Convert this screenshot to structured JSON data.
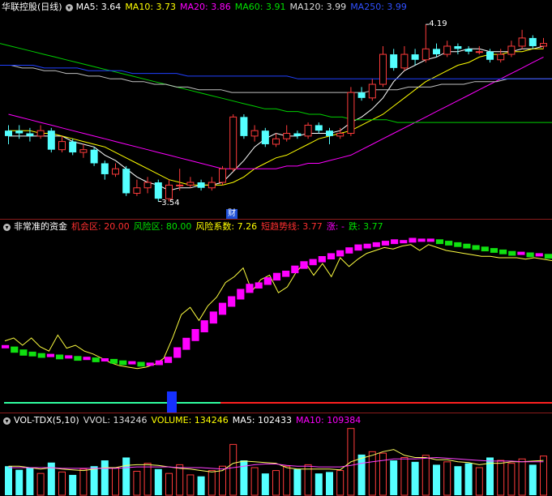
{
  "main_panel": {
    "title": "华联控股(日线)",
    "ma_items": [
      {
        "label": "MA5: 3.64",
        "color": "#ffffff"
      },
      {
        "label": "MA10: 3.73",
        "color": "#ffff00"
      },
      {
        "label": "MA20: 3.86",
        "color": "#ff00ff"
      },
      {
        "label": "MA60: 3.91",
        "color": "#00e000"
      },
      {
        "label": "MA120: 3.99",
        "color": "#dddddd"
      },
      {
        "label": "MA250: 3.99",
        "color": "#3050ff"
      }
    ],
    "high_label": "4.19",
    "low_label": "3.54",
    "finance_badge": "财"
  },
  "indicator_panel": {
    "title": "非常准的资金",
    "items": [
      {
        "label": "机会区: 20.00",
        "color": "#ff3030"
      },
      {
        "label": "风险区: 80.00",
        "color": "#00e000"
      },
      {
        "label": "风险系数: 7.26",
        "color": "#ffff00"
      },
      {
        "label": "短趋势线: 3.77",
        "color": "#ff3030"
      },
      {
        "label": "涨: -",
        "color": "#ff00ff"
      },
      {
        "label": "跌: 3.77",
        "color": "#00e000"
      }
    ]
  },
  "volume_panel": {
    "title": "VOL-TDX(5,10)",
    "items": [
      {
        "label": "VVOL: 134246",
        "color": "#dddddd"
      },
      {
        "label": "VOLUME: 134246",
        "color": "#ffff00"
      },
      {
        "label": "MA5: 102433",
        "color": "#ffffff"
      },
      {
        "label": "MA10: 109384",
        "color": "#ff00ff"
      }
    ]
  },
  "colors": {
    "up": "#ff3b3b",
    "down": "#54ffff",
    "background": "#000000"
  },
  "candles": [
    [
      3.8,
      3.78,
      3.82,
      3.75
    ],
    [
      3.8,
      3.79,
      3.82,
      3.77
    ],
    [
      3.79,
      3.78,
      3.81,
      3.76
    ],
    [
      3.78,
      3.8,
      3.82,
      3.77
    ],
    [
      3.8,
      3.73,
      3.81,
      3.72
    ],
    [
      3.73,
      3.76,
      3.78,
      3.72
    ],
    [
      3.76,
      3.72,
      3.77,
      3.71
    ],
    [
      3.72,
      3.73,
      3.75,
      3.7
    ],
    [
      3.73,
      3.68,
      3.74,
      3.67
    ],
    [
      3.68,
      3.64,
      3.69,
      3.62
    ],
    [
      3.64,
      3.66,
      3.68,
      3.63
    ],
    [
      3.66,
      3.57,
      3.67,
      3.56
    ],
    [
      3.57,
      3.59,
      3.62,
      3.56
    ],
    [
      3.59,
      3.61,
      3.63,
      3.57
    ],
    [
      3.61,
      3.55,
      3.62,
      3.54
    ],
    [
      3.55,
      3.6,
      3.62,
      3.54
    ],
    [
      3.6,
      3.6,
      3.66,
      3.58
    ],
    [
      3.6,
      3.61,
      3.63,
      3.59
    ],
    [
      3.61,
      3.59,
      3.62,
      3.58
    ],
    [
      3.59,
      3.61,
      3.63,
      3.58
    ],
    [
      3.61,
      3.66,
      3.67,
      3.6
    ],
    [
      3.66,
      3.85,
      3.86,
      3.65
    ],
    [
      3.85,
      3.78,
      3.86,
      3.77
    ],
    [
      3.78,
      3.8,
      3.82,
      3.76
    ],
    [
      3.8,
      3.75,
      3.81,
      3.74
    ],
    [
      3.75,
      3.77,
      3.79,
      3.74
    ],
    [
      3.77,
      3.79,
      3.82,
      3.76
    ],
    [
      3.79,
      3.78,
      3.8,
      3.77
    ],
    [
      3.78,
      3.82,
      3.83,
      3.77
    ],
    [
      3.82,
      3.8,
      3.83,
      3.79
    ],
    [
      3.8,
      3.78,
      3.81,
      3.75
    ],
    [
      3.78,
      3.79,
      3.81,
      3.77
    ],
    [
      3.79,
      3.94,
      3.96,
      3.78
    ],
    [
      3.94,
      3.92,
      3.96,
      3.91
    ],
    [
      3.92,
      3.97,
      3.99,
      3.91
    ],
    [
      3.97,
      4.08,
      4.11,
      3.96
    ],
    [
      4.08,
      4.03,
      4.1,
      4.02
    ],
    [
      4.03,
      4.08,
      4.11,
      4.02
    ],
    [
      4.08,
      4.06,
      4.1,
      4.04
    ],
    [
      4.06,
      4.1,
      4.19,
      4.05
    ],
    [
      4.1,
      4.08,
      4.12,
      4.07
    ],
    [
      4.08,
      4.11,
      4.13,
      4.07
    ],
    [
      4.11,
      4.1,
      4.12,
      4.08
    ],
    [
      4.1,
      4.09,
      4.11,
      4.08
    ],
    [
      4.09,
      4.09,
      4.11,
      4.08
    ],
    [
      4.09,
      4.06,
      4.1,
      4.05
    ],
    [
      4.06,
      4.08,
      4.1,
      4.05
    ],
    [
      4.08,
      4.11,
      4.13,
      4.07
    ],
    [
      4.11,
      4.14,
      4.17,
      4.1
    ],
    [
      4.14,
      4.11,
      4.15,
      4.1
    ],
    [
      4.11,
      4.12,
      4.14,
      4.1
    ]
  ],
  "ma_series": {
    "ma5": [
      3.78,
      3.78,
      3.78,
      3.78,
      3.78,
      3.78,
      3.76,
      3.75,
      3.74,
      3.71,
      3.69,
      3.66,
      3.63,
      3.61,
      3.6,
      3.58,
      3.59,
      3.59,
      3.6,
      3.6,
      3.61,
      3.65,
      3.69,
      3.74,
      3.77,
      3.79,
      3.78,
      3.78,
      3.79,
      3.79,
      3.79,
      3.8,
      3.83,
      3.85,
      3.88,
      3.92,
      3.98,
      4.02,
      4.04,
      4.06,
      4.07,
      4.09,
      4.09,
      4.1,
      4.1,
      4.09,
      4.09,
      4.09,
      4.1,
      4.1,
      4.11
    ],
    "ma10": [
      3.8,
      3.8,
      3.8,
      3.79,
      3.79,
      3.78,
      3.77,
      3.76,
      3.75,
      3.74,
      3.72,
      3.7,
      3.68,
      3.66,
      3.64,
      3.62,
      3.61,
      3.6,
      3.6,
      3.6,
      3.6,
      3.61,
      3.63,
      3.66,
      3.68,
      3.7,
      3.71,
      3.73,
      3.75,
      3.77,
      3.78,
      3.79,
      3.8,
      3.82,
      3.84,
      3.86,
      3.89,
      3.92,
      3.95,
      3.98,
      4.0,
      4.02,
      4.04,
      4.05,
      4.07,
      4.08,
      4.08,
      4.09,
      4.09,
      4.1,
      4.1
    ],
    "ma20": [
      3.86,
      3.85,
      3.84,
      3.83,
      3.82,
      3.81,
      3.8,
      3.79,
      3.78,
      3.77,
      3.76,
      3.75,
      3.74,
      3.73,
      3.72,
      3.71,
      3.7,
      3.69,
      3.68,
      3.67,
      3.66,
      3.66,
      3.66,
      3.66,
      3.66,
      3.66,
      3.67,
      3.67,
      3.68,
      3.68,
      3.69,
      3.7,
      3.71,
      3.73,
      3.75,
      3.77,
      3.79,
      3.81,
      3.83,
      3.85,
      3.87,
      3.89,
      3.91,
      3.93,
      3.95,
      3.97,
      3.99,
      4.01,
      4.03,
      4.05,
      4.07
    ],
    "ma60": [
      4.12,
      4.11,
      4.1,
      4.09,
      4.08,
      4.07,
      4.06,
      4.05,
      4.04,
      4.03,
      4.02,
      4.01,
      4.0,
      3.99,
      3.98,
      3.97,
      3.96,
      3.95,
      3.94,
      3.93,
      3.92,
      3.91,
      3.9,
      3.89,
      3.88,
      3.88,
      3.87,
      3.87,
      3.86,
      3.86,
      3.85,
      3.85,
      3.84,
      3.84,
      3.84,
      3.84,
      3.83,
      3.83,
      3.83,
      3.83,
      3.83,
      3.83,
      3.83,
      3.83,
      3.83,
      3.83,
      3.83,
      3.83,
      3.83,
      3.83,
      3.83
    ],
    "ma120": [
      4.04,
      4.04,
      4.03,
      4.03,
      4.02,
      4.02,
      4.01,
      4.01,
      4.0,
      4.0,
      3.99,
      3.99,
      3.98,
      3.98,
      3.97,
      3.97,
      3.96,
      3.96,
      3.95,
      3.95,
      3.95,
      3.94,
      3.94,
      3.94,
      3.94,
      3.94,
      3.94,
      3.94,
      3.94,
      3.94,
      3.94,
      3.94,
      3.94,
      3.94,
      3.95,
      3.95,
      3.95,
      3.96,
      3.96,
      3.96,
      3.97,
      3.97,
      3.97,
      3.98,
      3.98,
      3.98,
      3.99,
      3.99,
      3.99,
      3.99,
      3.99
    ],
    "ma250": [
      4.04,
      4.04,
      4.04,
      4.04,
      4.03,
      4.03,
      4.03,
      4.03,
      4.02,
      4.02,
      4.02,
      4.02,
      4.01,
      4.01,
      4.01,
      4.01,
      4.01,
      4.0,
      4.0,
      4.0,
      4.0,
      4.0,
      4.0,
      4.0,
      4.0,
      4.0,
      4.0,
      3.99,
      3.99,
      3.99,
      3.99,
      3.99,
      3.99,
      3.99,
      3.99,
      3.99,
      3.99,
      3.99,
      3.99,
      3.99,
      3.99,
      3.99,
      3.99,
      3.99,
      3.99,
      3.99,
      3.99,
      3.99,
      3.99,
      3.99,
      3.99
    ]
  },
  "price_range": [
    3.5,
    4.22
  ],
  "fund_line": [
    28,
    30,
    25,
    30,
    24,
    21,
    32,
    23,
    25,
    21,
    19,
    16,
    13,
    11,
    10,
    9,
    10,
    12,
    16,
    30,
    46,
    51,
    42,
    52,
    58,
    68,
    72,
    78,
    62,
    70,
    73,
    61,
    65,
    75,
    82,
    73,
    81,
    72,
    85,
    79,
    84,
    88,
    90,
    92,
    91,
    93,
    94,
    90,
    94,
    92,
    90,
    89,
    88,
    87,
    86,
    86,
    85,
    85,
    85,
    84,
    85,
    84,
    83
  ],
  "fund_bars": [
    24,
    22,
    20,
    19,
    18,
    18,
    17,
    17,
    16,
    16,
    15,
    15,
    14,
    13,
    13,
    12,
    12,
    13,
    15,
    20,
    26,
    32,
    38,
    44,
    50,
    55,
    60,
    64,
    66,
    69,
    72,
    74,
    77,
    80,
    82,
    84,
    86,
    88,
    90,
    92,
    93,
    94,
    95,
    96,
    96,
    97,
    97,
    97,
    96,
    95,
    94,
    93,
    92,
    91,
    90,
    89,
    88,
    88,
    87,
    87,
    86
  ],
  "fund_range": [
    0,
    100
  ],
  "volumes": [
    40,
    35,
    38,
    30,
    45,
    32,
    28,
    36,
    40,
    48,
    38,
    52,
    33,
    44,
    36,
    30,
    42,
    28,
    26,
    34,
    40,
    70,
    48,
    38,
    30,
    34,
    40,
    36,
    42,
    30,
    32,
    34,
    92,
    56,
    60,
    58,
    48,
    52,
    46,
    55,
    42,
    46,
    40,
    44,
    38,
    52,
    48,
    44,
    50,
    42,
    54
  ],
  "volume_ma5": [
    40,
    40,
    38,
    36,
    38,
    36,
    35,
    34,
    36,
    38,
    38,
    41,
    42,
    42,
    41,
    39,
    37,
    36,
    34,
    32,
    34,
    44,
    47,
    46,
    45,
    44,
    38,
    36,
    36,
    36,
    36,
    35,
    46,
    51,
    55,
    60,
    63,
    55,
    52,
    52,
    49,
    49,
    46,
    45,
    42,
    44,
    44,
    46,
    46,
    47,
    48
  ],
  "volume_ma10": [
    38,
    38,
    38,
    38,
    38,
    37,
    37,
    37,
    37,
    37,
    37,
    38,
    39,
    39,
    39,
    39,
    38,
    38,
    38,
    37,
    36,
    38,
    40,
    42,
    43,
    43,
    41,
    40,
    40,
    39,
    39,
    39,
    41,
    44,
    46,
    48,
    50,
    50,
    50,
    51,
    52,
    51,
    50,
    49,
    48,
    47,
    47,
    47,
    46,
    46,
    46
  ],
  "volume_range": [
    0,
    95
  ]
}
